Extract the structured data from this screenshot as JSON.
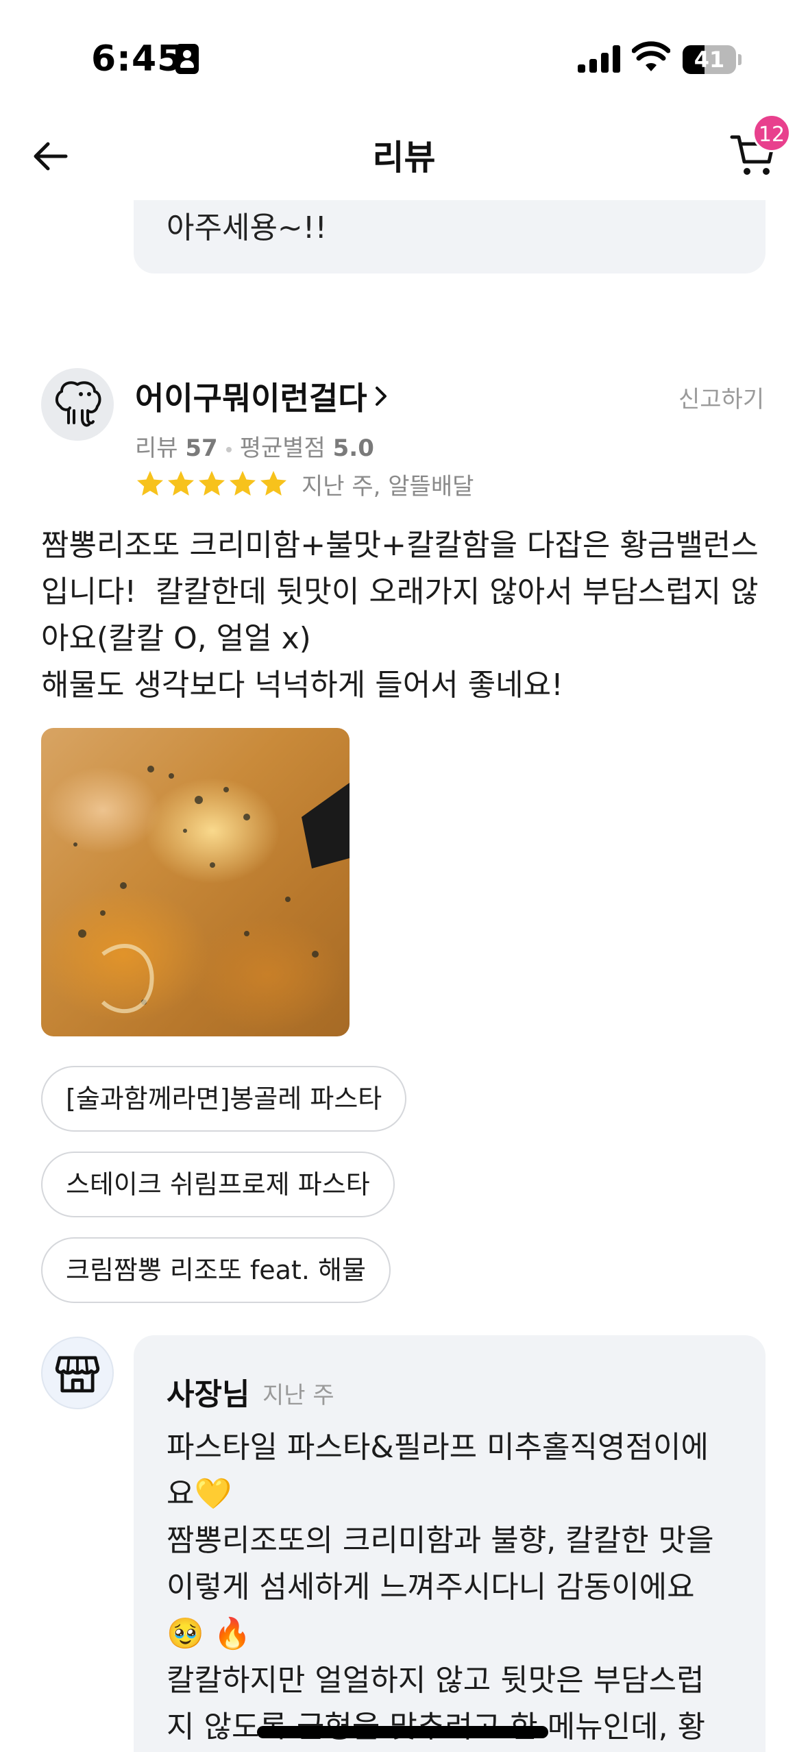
{
  "status_bar": {
    "time": "6:45",
    "battery": "41",
    "battery_level": 0.41
  },
  "nav": {
    "title": "리뷰",
    "cart_count": "12"
  },
  "previous_review": {
    "text_tail": "아주세용~!!"
  },
  "review": {
    "reviewer_name": "어이구뭐이런걸다",
    "report_label": "신고하기",
    "review_count_label": "리뷰",
    "review_count": "57",
    "avg_rating_label": "평균별점",
    "avg_rating": "5.0",
    "stars": 5,
    "meta": "지난 주, 알뜰배달",
    "text": "짬뽕리조또 크리미함+불맛+칼칼함을 다잡은 황금밸런스\n입니다!  칼칼한데 뒷맛이 오래가지 않아서 부담스럽지 않\n아요(칼칼 O, 얼얼 x)\n해물도 생각보다 넉넉하게 들어서 좋네요!",
    "ordered_menus": [
      "[술과함께라면]봉골레 파스타",
      "스테이크 쉬림프로제 파스타",
      "크림짬뽕 리조또 feat. 해물"
    ]
  },
  "owner_reply": {
    "name": "사장님",
    "time": "지난 주",
    "text": "파스타일 파스타&필라프 미추홀직영점이에\n요💛\n짬뽕리조또의 크리미함과 불향, 칼칼한 맛을\n이렇게 섬세하게 느껴주시다니 감동이에요\n🥹 🔥\n칼칼하지만 얼얼하지 않고 뒷맛은 부담스럽\n지 않도록 균형을 맞추려고 한 메뉴인데, 황"
  },
  "colors": {
    "badge": "#e8408d",
    "star": "#f7c21c",
    "bubble_bg": "#f1f3f6",
    "muted_text": "#9a9a9a"
  },
  "icons": [
    "back-arrow-icon",
    "cart-icon",
    "elephant-avatar-icon",
    "chevron-right-icon",
    "star-icon",
    "store-icon",
    "signal-icon",
    "wifi-icon",
    "battery-icon"
  ]
}
